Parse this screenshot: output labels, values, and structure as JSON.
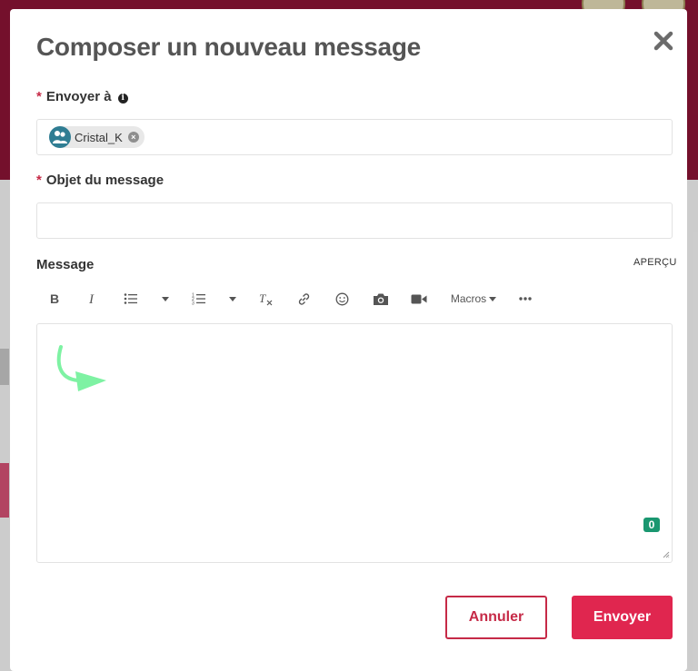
{
  "modal": {
    "title": "Composer un nouveau message",
    "close_icon": "close-icon"
  },
  "recipient": {
    "label": "Envoyer à",
    "required_mark": "*",
    "info_icon": "info-icon",
    "chips": [
      {
        "name": "Cristal_K",
        "avatar_icon": "user-group-icon",
        "remove_icon": "remove-chip-icon"
      }
    ]
  },
  "subject": {
    "label": "Objet du message",
    "required_mark": "*",
    "value": ""
  },
  "message": {
    "label": "Message",
    "preview_link": "APERÇU",
    "value": "",
    "char_count": "0",
    "toolbar": {
      "bold": "bold-icon",
      "italic": "italic-icon",
      "bullet_list": "bullet-list-icon",
      "numbered_list": "numbered-list-icon",
      "clear_format": "clear-format-icon",
      "link": "link-icon",
      "emoji": "emoji-icon",
      "image": "camera-icon",
      "video": "video-icon",
      "macros_label": "Macros",
      "more": "more-icon"
    }
  },
  "actions": {
    "cancel_label": "Annuler",
    "send_label": "Envoyer"
  },
  "colors": {
    "accent": "#e0264f",
    "header_bg": "#7e1230",
    "counter_badge": "#1a9770",
    "annotation_arrow": "#7ef2a3"
  }
}
